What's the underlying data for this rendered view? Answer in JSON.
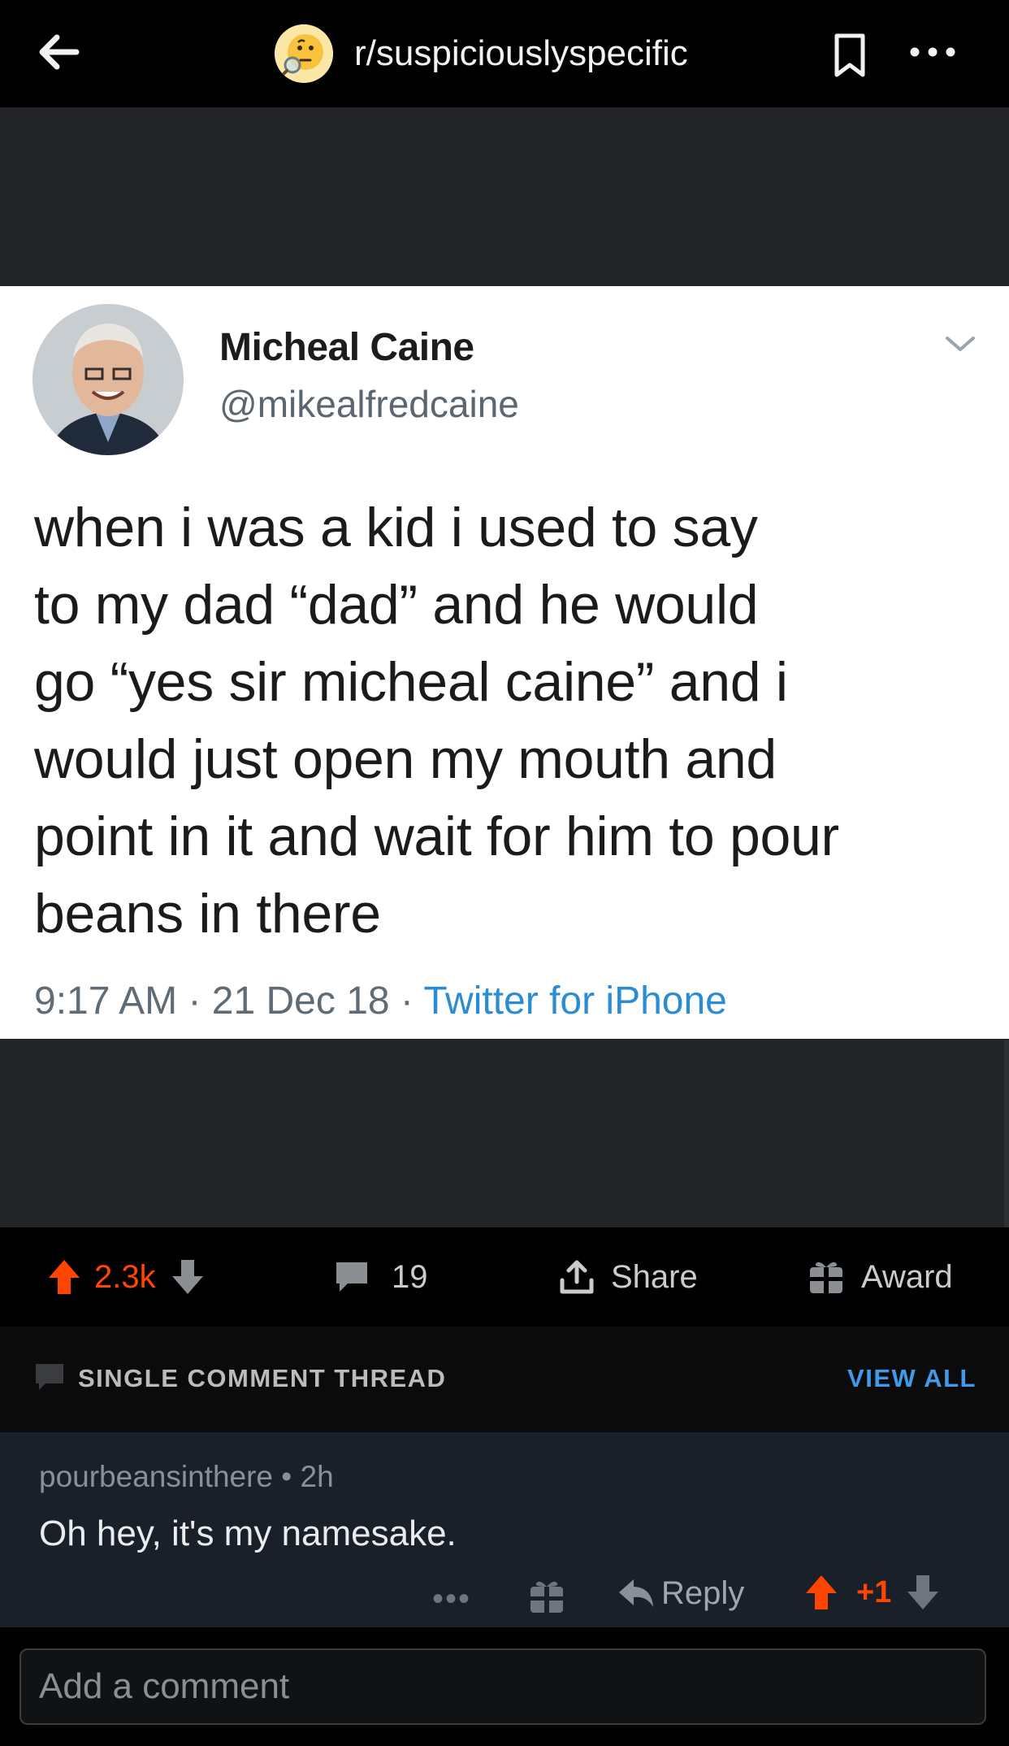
{
  "header": {
    "subreddit": "r/suspiciouslyspecific",
    "icons": [
      "back-arrow-icon",
      "subreddit-thinking-face-icon",
      "bookmark-icon",
      "more-dots-icon"
    ]
  },
  "tweet": {
    "display_name": "Micheal Caine",
    "handle": "@mikealfredcaine",
    "lines": [
      "when i was a kid i used to say",
      "to my dad “dad” and he would",
      "go “yes sir micheal caine” and i",
      "would just open my mouth and",
      "point in it and wait for him to pour",
      "beans in there"
    ],
    "time": "9:17 AM",
    "date": "21 Dec 18",
    "source": "Twitter for iPhone"
  },
  "actions": {
    "votes": "2.3k",
    "comments": "19",
    "share": "Share",
    "award": "Award"
  },
  "thread": {
    "label": "SINGLE COMMENT THREAD",
    "view_all": "VIEW ALL"
  },
  "comment": {
    "author": "pourbeansinthere",
    "age": "2h",
    "body": "Oh hey, it's my namesake.",
    "more": "•••",
    "reply": "Reply",
    "score": "+1"
  },
  "composer": {
    "placeholder": "Add a comment"
  },
  "colors": {
    "upvote": "#ff4500",
    "link_blue": "#3f9bea",
    "twitter_blue": "#2b8cd6",
    "comment_bg": "#1a2029"
  }
}
